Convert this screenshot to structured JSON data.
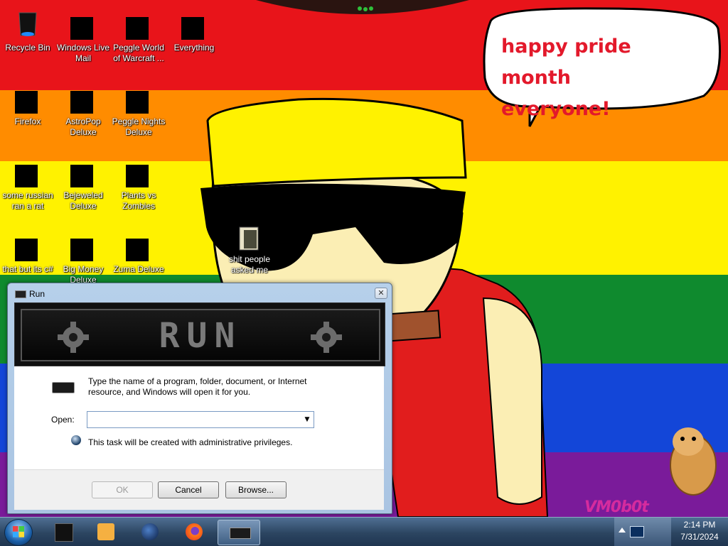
{
  "wallpaper": {
    "speech_bubble": [
      "happy pride month",
      "everyone!"
    ],
    "signature": "VM0b0t"
  },
  "desktop_icons": [
    {
      "label": "Recycle Bin",
      "icon": "recycle-bin-icon"
    },
    {
      "label": "Windows Live\nMail",
      "icon": "mail-icon"
    },
    {
      "label": "Peggle World\nof Warcraft ...",
      "icon": "game-icon"
    },
    {
      "label": "Everything",
      "icon": "search-icon"
    },
    {
      "label": "Firefox",
      "icon": "firefox-icon"
    },
    {
      "label": "AstroPop\nDeluxe",
      "icon": "game-icon"
    },
    {
      "label": "Peggle Nights\nDeluxe",
      "icon": "game-icon"
    },
    {
      "label": "some russian\nran a rat",
      "icon": "program-icon"
    },
    {
      "label": "Bejeweled\nDeluxe",
      "icon": "gem-icon"
    },
    {
      "label": "Plants vs\nZombies",
      "icon": "game-icon"
    },
    {
      "label": "that but its c#",
      "icon": "program-icon"
    },
    {
      "label": "Big Money\nDeluxe",
      "icon": "game-icon"
    },
    {
      "label": "Zuma Deluxe",
      "icon": "game-icon"
    },
    {
      "label": "shit people\nasked me",
      "icon": "folder-icon"
    }
  ],
  "run_dialog": {
    "title": "Run",
    "banner_text": "RUN",
    "instructions": "Type the name of a program, folder, document, or Internet resource, and Windows will open it for you.",
    "open_label": "Open:",
    "open_value": "",
    "admin_note": "This task will be created with administrative privileges.",
    "buttons": {
      "ok": "OK",
      "cancel": "Cancel",
      "browse": "Browse..."
    }
  },
  "taskbar": {
    "items": [
      "media-icon",
      "media-player-icon",
      "globe-icon",
      "firefox-icon",
      "run-icon"
    ],
    "clock": {
      "time": "2:14 PM",
      "date": "7/31/2024"
    }
  },
  "colors": {
    "stripes": [
      "#e8141a",
      "#ff8c00",
      "#fff200",
      "#0f8a2e",
      "#1346d8",
      "#7a1b9a"
    ],
    "speech_text": "#e3192b"
  }
}
